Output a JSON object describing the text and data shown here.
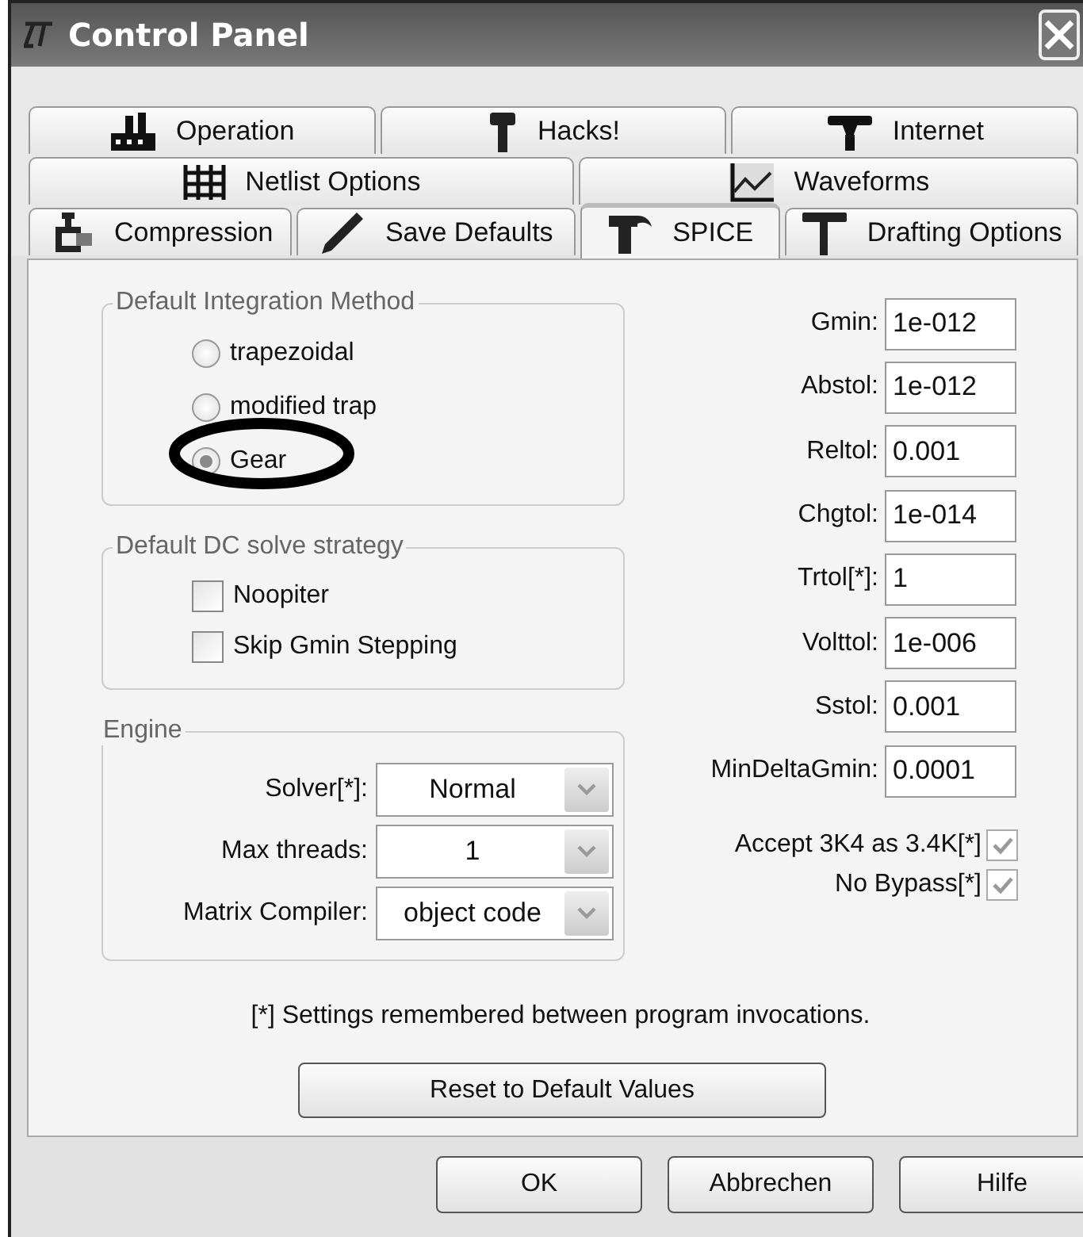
{
  "window": {
    "title": "Control Panel"
  },
  "tab_rows": [
    [
      {
        "label": "Operation",
        "selected": false
      },
      {
        "label": "Hacks!",
        "selected": false
      },
      {
        "label": "Internet",
        "selected": false
      }
    ],
    [
      {
        "label": "Netlist Options",
        "selected": false
      },
      {
        "label": "Waveforms",
        "selected": false
      }
    ],
    [
      {
        "label": "Compression",
        "selected": false
      },
      {
        "label": "Save Defaults",
        "selected": false
      },
      {
        "label": "SPICE",
        "selected": true
      },
      {
        "label": "Drafting Options",
        "selected": false
      }
    ]
  ],
  "integration_method": {
    "title": "Default Integration Method",
    "options": [
      {
        "label": "trapezoidal",
        "selected": false
      },
      {
        "label": "modified trap",
        "selected": false
      },
      {
        "label": "Gear",
        "selected": true
      }
    ]
  },
  "dc_strategy": {
    "title": "Default DC solve strategy",
    "options": [
      {
        "label": "Noopiter",
        "checked": false
      },
      {
        "label": "Skip Gmin Stepping",
        "checked": false
      }
    ]
  },
  "engine": {
    "title": "Engine",
    "rows": [
      {
        "label": "Solver[*]:",
        "value": "Normal"
      },
      {
        "label": "Max threads:",
        "value": "1"
      },
      {
        "label": "Matrix Compiler:",
        "value": "object code"
      }
    ]
  },
  "tolerances": [
    {
      "label": "Gmin:",
      "value": "1e-012"
    },
    {
      "label": "Abstol:",
      "value": "1e-012"
    },
    {
      "label": "Reltol:",
      "value": "0.001"
    },
    {
      "label": "Chgtol:",
      "value": "1e-014"
    },
    {
      "label": "Trtol[*]:",
      "value": "1"
    },
    {
      "label": "Volttol:",
      "value": "1e-006"
    },
    {
      "label": "Sstol:",
      "value": "0.001"
    },
    {
      "label": "MinDeltaGmin:",
      "value": "0.0001"
    }
  ],
  "options": [
    {
      "label": "Accept 3K4 as 3.4K[*]",
      "checked": true
    },
    {
      "label": "No Bypass[*]",
      "checked": true
    }
  ],
  "note": "[*] Settings remembered between program invocations.",
  "reset_button": "Reset to Default Values",
  "annotation": {
    "kind": "circle"
  },
  "buttons": [
    "OK",
    "Abbrechen",
    "Hilfe"
  ]
}
